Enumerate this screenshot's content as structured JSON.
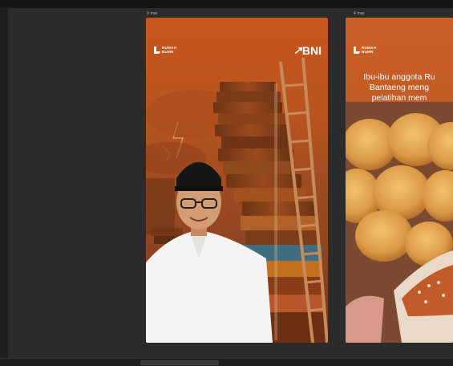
{
  "canvas": {
    "frames": [
      {
        "label": "3 mai",
        "logo_line1": "RUMAH",
        "logo_line2": "BUMN",
        "brand_name": "BNI",
        "brand_arrow": "↗"
      },
      {
        "label": "4 mai",
        "logo_line1": "RUMAH",
        "logo_line2": "BUMN",
        "headline_lines": [
          "Ibu-ibu anggota Ru",
          "Bantaeng meng",
          "pelatihan mem"
        ]
      }
    ]
  },
  "status_bar": {
    "text": ""
  },
  "colors": {
    "app_background": "#1e1e1e",
    "canvas_background": "#2b2b2b",
    "frame_orange": "#c7561e",
    "bun_gold": "#e1a451"
  }
}
